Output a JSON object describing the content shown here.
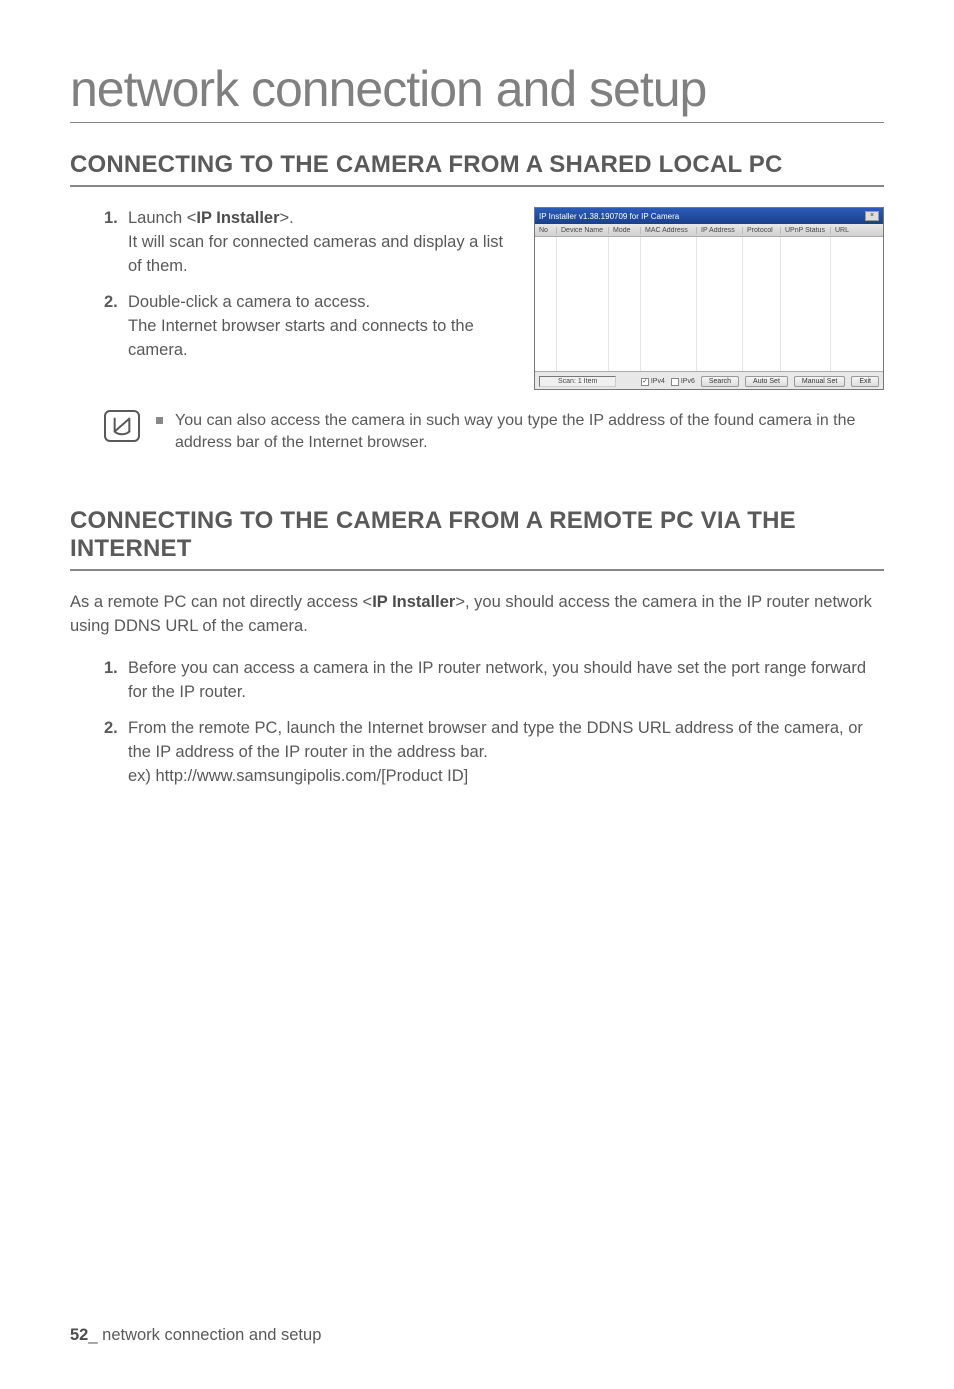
{
  "page": {
    "title": "network connection and setup",
    "footer_page": "52",
    "footer_separator": "_",
    "footer_text": "network connection and setup"
  },
  "section1": {
    "heading": "CONNECTING TO THE CAMERA FROM A SHARED LOCAL PC",
    "steps": [
      {
        "num": "1.",
        "text_before": "Launch <",
        "bold": "IP Installer",
        "text_after": ">.",
        "text_line2": "It will scan for connected cameras and display a list of them."
      },
      {
        "num": "2.",
        "text_line1": "Double-click a camera to access.",
        "text_line2": "The Internet browser starts and connects to the camera."
      }
    ],
    "note": "You can also access the camera in such way you type the IP address of the found camera in the address bar of the Internet browser."
  },
  "installer": {
    "title_text": "IP Installer v1.38.190709 for IP Camera",
    "close_glyph": "×",
    "columns": [
      "No",
      "Device Name",
      "Mode",
      "MAC Address",
      "IP Address",
      "Protocol",
      "UPnP Status",
      "URL"
    ],
    "status": "Scan: 1 Item",
    "chk1_label": "IPv4",
    "chk1_checked": "✓",
    "chk2_label": "IPv6",
    "chk2_checked": "",
    "btn_search": "Search",
    "btn_auto": "Auto Set",
    "btn_manual": "Manual Set",
    "btn_exit": "Exit"
  },
  "section2": {
    "heading": "CONNECTING TO THE CAMERA FROM A REMOTE PC VIA THE INTERNET",
    "intro_before": "As a remote PC can not directly access <",
    "intro_bold": "IP Installer",
    "intro_after": ">, you should access the camera in the IP router network using DDNS URL of the camera.",
    "steps": [
      {
        "num": "1.",
        "text": "Before you can access a camera in the IP router network, you should have set the port range forward for the IP router."
      },
      {
        "num": "2.",
        "text_line1": "From the remote PC, launch the Internet browser and type the DDNS URL address of the camera, or the IP address of the IP router in the address bar.",
        "text_line2": "ex) http://www.samsungipolis.com/[Product ID]"
      }
    ]
  }
}
